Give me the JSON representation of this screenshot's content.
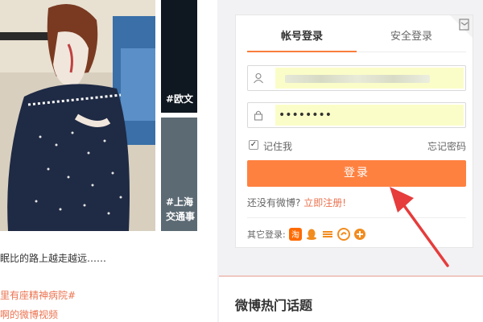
{
  "login": {
    "tab_account": "帐号登录",
    "tab_secure": "安全登录",
    "password_mask": "••••••••",
    "remember_label": "记住我",
    "forgot_label": "忘记密码",
    "login_button": "登录",
    "no_account_text": "还没有微博?",
    "register_link": "立即注册!",
    "other_login_label": "其它登录:",
    "social_icons": [
      "taobao-icon",
      "qq-icon",
      "tianyi-icon",
      "baidu-icon",
      "more-icon"
    ]
  },
  "feed": {
    "side_tag_1": "#欧文",
    "side_tag_2": "#上海",
    "side_tag_3": "交通事",
    "post_text": "眠比的路上越走越远……",
    "topic_1": "里有座精神病院#",
    "topic_2": "啊的微博视频"
  },
  "hot": {
    "title": "微博热门话题"
  },
  "colors": {
    "accent": "#ff8140",
    "link": "#eb7350",
    "autofill": "#fbfdc8",
    "arrow": "#e63c3c"
  }
}
